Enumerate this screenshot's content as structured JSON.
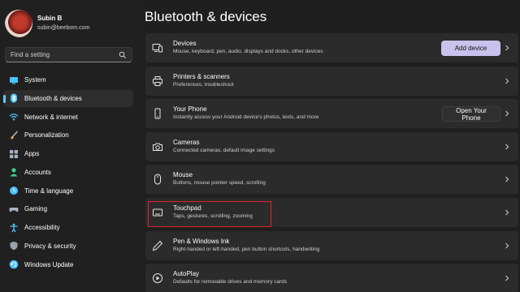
{
  "profile": {
    "name": "Subin B",
    "email": "subin@beebom.com"
  },
  "search": {
    "placeholder": "Find a setting"
  },
  "sidebar": {
    "items": [
      {
        "label": "System",
        "icon": "monitor-icon",
        "color": "#4cc2ff"
      },
      {
        "label": "Bluetooth & devices",
        "icon": "bluetooth-icon",
        "color": "#4cc2ff",
        "active": true
      },
      {
        "label": "Network & internet",
        "icon": "wifi-icon",
        "color": "#4cc2ff"
      },
      {
        "label": "Personalization",
        "icon": "brush-icon",
        "color": "#e8a14d"
      },
      {
        "label": "Apps",
        "icon": "apps-icon",
        "color": "#a8b3c4"
      },
      {
        "label": "Accounts",
        "icon": "person-icon",
        "color": "#3fcf8e"
      },
      {
        "label": "Time & language",
        "icon": "globe-clock-icon",
        "color": "#4cc2ff"
      },
      {
        "label": "Gaming",
        "icon": "gamepad-icon",
        "color": "#a8b3c4"
      },
      {
        "label": "Accessibility",
        "icon": "accessibility-icon",
        "color": "#4cc2ff"
      },
      {
        "label": "Privacy & security",
        "icon": "shield-icon",
        "color": "#9aa3ad"
      },
      {
        "label": "Windows Update",
        "icon": "update-icon",
        "color": "#4cc2ff"
      }
    ]
  },
  "main": {
    "title": "Bluetooth & devices",
    "rows": [
      {
        "title": "Devices",
        "desc": "Mouse, keyboard, pen, audio, displays and docks, other devices",
        "icon": "devices-icon",
        "button": "Add device"
      },
      {
        "title": "Printers & scanners",
        "desc": "Preferences, troubleshoot",
        "icon": "printer-icon"
      },
      {
        "title": "Your Phone",
        "desc": "Instantly access your Android device's photos, texts, and more",
        "icon": "phone-icon",
        "button": "Open Your Phone"
      },
      {
        "title": "Cameras",
        "desc": "Connected cameras, default image settings",
        "icon": "camera-icon"
      },
      {
        "title": "Mouse",
        "desc": "Buttons, mouse pointer speed, scrolling",
        "icon": "mouse-icon"
      },
      {
        "title": "Touchpad",
        "desc": "Taps, gestures, scrolling, zooming",
        "icon": "touchpad-icon"
      },
      {
        "title": "Pen & Windows Ink",
        "desc": "Right-handed or left-handed, pen button shortcuts, handwriting",
        "icon": "pen-icon"
      },
      {
        "title": "AutoPlay",
        "desc": "Defaults for removable drives and memory cards",
        "icon": "autoplay-icon"
      }
    ]
  },
  "colors": {
    "accent": "#60cdff",
    "highlight": "#e0242b",
    "button_accent": "#c9c2ec"
  }
}
